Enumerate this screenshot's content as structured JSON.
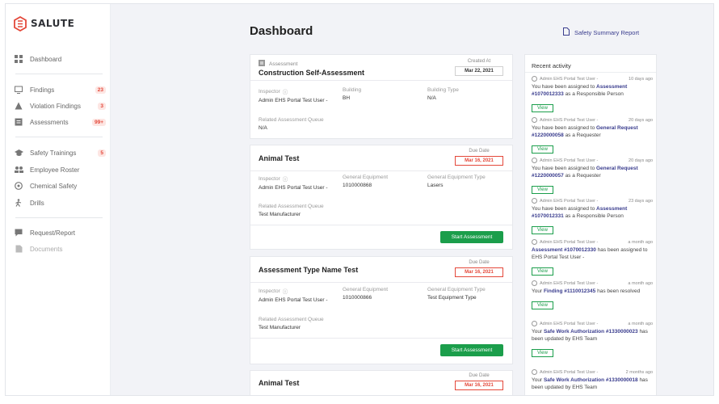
{
  "app": {
    "name": "SALUTE"
  },
  "sidebar": {
    "items": [
      {
        "label": "Dashboard",
        "icon": "dashboard-icon"
      },
      {
        "label": "Findings",
        "badge": "23",
        "icon": "findings-icon"
      },
      {
        "label": "Violation Findings",
        "badge": "3",
        "icon": "warning-icon"
      },
      {
        "label": "Assessments",
        "badge": "99+",
        "icon": "assessments-icon"
      },
      {
        "label": "Safety Trainings",
        "badge": "5",
        "icon": "graduation-cap-icon"
      },
      {
        "label": "Employee Roster",
        "icon": "roster-icon"
      },
      {
        "label": "Chemical Safety",
        "icon": "chemical-icon"
      },
      {
        "label": "Drills",
        "icon": "drill-icon"
      },
      {
        "label": "Request/Report",
        "icon": "request-icon"
      },
      {
        "label": "Documents",
        "icon": "documents-icon"
      }
    ]
  },
  "header": {
    "title": "Dashboard",
    "report_link": "Safety Summary Report"
  },
  "cards": [
    {
      "type_label": "Assessment",
      "title": "Construction Self-Assessment",
      "date_label": "Created At",
      "date": "Mar 22, 2021",
      "fields": {
        "inspector_k": "Inspector",
        "inspector_v": "Admin EHS Portal Test User -",
        "f2_k": "Building",
        "f2_v": "BH",
        "f3_k": "Building Type",
        "f3_v": "N/A",
        "queue_k": "Related Assessment Queue",
        "queue_v": "N/A"
      }
    },
    {
      "title": "Animal Test",
      "date_label": "Due Date",
      "date": "Mar 16, 2021",
      "fields": {
        "inspector_k": "Inspector",
        "inspector_v": "Admin EHS Portal Test User -",
        "f2_k": "General Equipment",
        "f2_v": "1010000868",
        "f3_k": "General Equipment Type",
        "f3_v": "Lasers",
        "queue_k": "Related Assessment Queue",
        "queue_v": "Test Manufacturer"
      },
      "button": "Start Assessment"
    },
    {
      "title": "Assessment Type Name Test",
      "date_label": "Due Date",
      "date": "Mar 16, 2021",
      "fields": {
        "inspector_k": "Inspector",
        "inspector_v": "Admin EHS Portal Test User -",
        "f2_k": "General Equipment",
        "f2_v": "1010000866",
        "f3_k": "General Equipment Type",
        "f3_v": "Test Equipment Type",
        "queue_k": "Related Assessment Queue",
        "queue_v": "Test Manufacturer"
      },
      "button": "Start Assessment"
    },
    {
      "title": "Animal Test",
      "date_label": "Due Date",
      "date": "Mar 16, 2021"
    }
  ],
  "activity": {
    "title": "Recent activity",
    "view_label": "View",
    "entries": [
      {
        "who": "Admin EHS Portal Test User -",
        "when": "10 days ago",
        "pre": "You have been assigned to ",
        "link": "Assessment #1070012333",
        "post": " as a Responsible Person"
      },
      {
        "who": "Admin EHS Portal Test User -",
        "when": "20 days ago",
        "pre": "You have been assigned to ",
        "link": "General Request #1220000058",
        "post": " as a Requester"
      },
      {
        "who": "Admin EHS Portal Test User -",
        "when": "20 days ago",
        "pre": "You have been assigned to ",
        "link": "General Request #1220000057",
        "post": " as a Requester"
      },
      {
        "who": "Admin EHS Portal Test User -",
        "when": "23 days ago",
        "pre": "You have been assigned to ",
        "link": "Assessment #1070012331",
        "post": " as a Responsible Person"
      },
      {
        "who": "Admin EHS Portal Test User -",
        "when": "a month ago",
        "pre": "",
        "link": "Assessment #1070012330",
        "post": " has been assigned to EHS Portal Test User -"
      },
      {
        "who": "Admin EHS Portal Test User -",
        "when": "a month ago",
        "pre": "Your ",
        "link": "Finding #1110012345",
        "post": " has been resolved"
      },
      {
        "who": "Admin EHS Portal Test User -",
        "when": "a month ago",
        "pre": "Your ",
        "link": "Safe Work Authorization #1330000023",
        "post": " has been updated by EHS Team"
      },
      {
        "who": "Admin EHS Portal Test User -",
        "when": "2 months ago",
        "pre": "Your ",
        "link": "Safe Work Authorization #1330000018",
        "post": " has been updated by EHS Team"
      }
    ]
  },
  "colors": {
    "brand": "#e4483a",
    "accent_link": "#3a3d8e",
    "button_green": "#1b9e4b",
    "background": "#f2f3f7"
  }
}
